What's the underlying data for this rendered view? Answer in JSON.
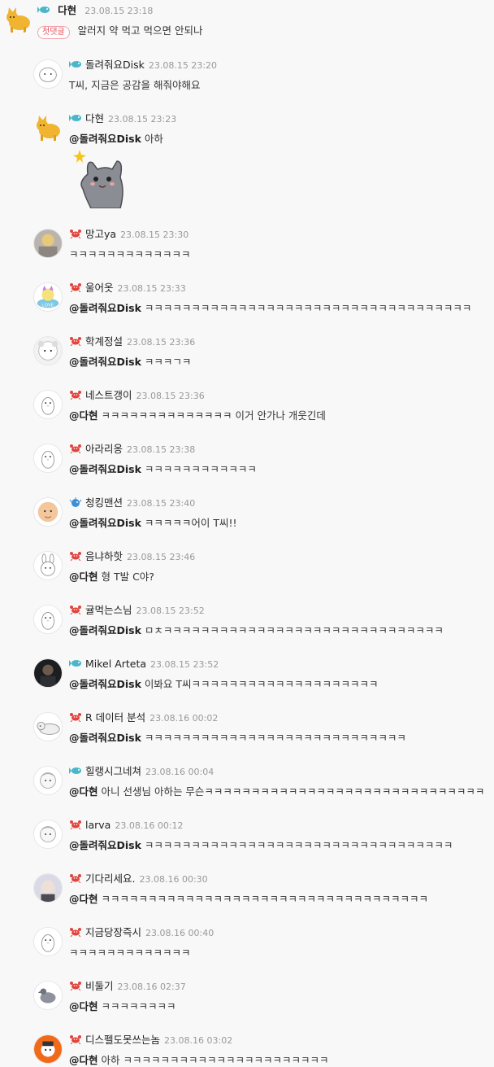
{
  "first_comment": {
    "nickname": "다현",
    "time": "23.08.15 23:18",
    "tag": "첫댓글",
    "text": "알러지 약 먹고 먹으면 안되나",
    "badge": "fish-badge",
    "avatar": "orange-cat"
  },
  "replies": [
    {
      "nickname": "돌려줘요Disk",
      "time": "23.08.15 23:20",
      "mention": "",
      "text": "T씨, 지금은 공감을 해줘야해요",
      "badge": "fish",
      "avatar": "white-blob"
    },
    {
      "nickname": "다현",
      "time": "23.08.15 23:23",
      "mention": "@돌려줘요Disk",
      "text": "아하",
      "badge": "fish",
      "avatar": "orange-cat",
      "sticker": "gray-cat-sticker"
    },
    {
      "nickname": "망고ya",
      "time": "23.08.15 23:30",
      "mention": "",
      "text": "ㅋㅋㅋㅋㅋㅋㅋㅋㅋㅋㅋㅋㅋ",
      "badge": "crab",
      "avatar": "photo-gray"
    },
    {
      "nickname": "울어옷",
      "time": "23.08.15 23:33",
      "mention": "@돌려줘요Disk",
      "text": "ㅋㅋㅋㅋㅋㅋㅋㅋㅋㅋㅋㅋㅋㅋㅋㅋㅋㅋㅋㅋㅋㅋㅋㅋㅋㅋㅋㅋㅋㅋㅋㅋㅋㅋㅋ",
      "badge": "crab",
      "avatar": "colorful-cat"
    },
    {
      "nickname": "학계정설",
      "time": "23.08.15 23:36",
      "mention": "@돌려줘요Disk",
      "text": "ㅋㅋㅋㄱㅋ",
      "badge": "crab",
      "avatar": "gray-bear"
    },
    {
      "nickname": "네스트갱이",
      "time": "23.08.15 23:36",
      "mention": "@다현",
      "text": "ㅋㅋㅋㅋㅋㅋㅋㅋㅋㅋㅋㅋㅋㅋ 이거 안가나 개웃긴데",
      "badge": "crab",
      "avatar": "penguin"
    },
    {
      "nickname": "아라리옹",
      "time": "23.08.15 23:38",
      "mention": "@돌려줘요Disk",
      "text": "ㅋㅋㅋㅋㅋㅋㅋㅋㅋㅋㅋㅋ",
      "badge": "crab",
      "avatar": "penguin"
    },
    {
      "nickname": "청킹맨션",
      "time": "23.08.15 23:40",
      "mention": "@돌려줘요Disk",
      "text": "ㅋㅋㅋㅋㅋ어이 T씨!!",
      "badge": "blowfish",
      "avatar": "bald-face"
    },
    {
      "nickname": "음냐하핫",
      "time": "23.08.15 23:46",
      "mention": "@다현",
      "text": "형 T발 C야?",
      "badge": "crab",
      "avatar": "bunny"
    },
    {
      "nickname": "귤먹는스님",
      "time": "23.08.15 23:52",
      "mention": "@돌려줘요Disk",
      "text": "ㅁㅊㅋㅋㅋㅋㅋㅋㅋㅋㅋㅋㅋㅋㅋㅋㅋㅋㅋㅋㅋㅋㅋㅋㅋㅋㅋㅋㅋㅋㅋㅋ",
      "badge": "crab",
      "avatar": "penguin"
    },
    {
      "nickname": "Mikel Arteta",
      "time": "23.08.15 23:52",
      "mention": "@돌려줘요Disk",
      "text": "이봐요 T씨ㅋㅋㅋㅋㅋㅋㅋㅋㅋㅋㅋㅋㅋㅋㅋㅋㅋㅋㅋㅋ",
      "badge": "fish",
      "avatar": "dark-photo"
    },
    {
      "nickname": "R 데이터 분석",
      "time": "23.08.16 00:02",
      "mention": "@돌려줘요Disk",
      "text": "ㅋㅋㅋㅋㅋㅋㅋㅋㅋㅋㅋㅋㅋㅋㅋㅋㅋㅋㅋㅋㅋㅋㅋㅋㅋㅋㅋㅋ",
      "badge": "crab",
      "avatar": "lying-cat"
    },
    {
      "nickname": "힐랭시그네쳐",
      "time": "23.08.16 00:04",
      "mention": "@다현",
      "text": "아니 선생님 아하는 무슨ㅋㅋㅋㅋㅋㅋㅋㅋㅋㅋㅋㅋㅋㅋㅋㅋㅋㅋㅋㅋㅋㅋㅋㅋㅋㅋㅋㅋㅋㅋ",
      "badge": "fish",
      "avatar": "sheep"
    },
    {
      "nickname": "larva",
      "time": "23.08.16 00:12",
      "mention": "@돌려줘요Disk",
      "text": "ㅋㅋㅋㅋㅋㅋㅋㅋㅋㅋㅋㅋㅋㅋㅋㅋㅋㅋㅋㅋㅋㅋㅋㅋㅋㅋㅋㅋㅋㅋㅋㅋㅋ",
      "badge": "crab",
      "avatar": "sheep"
    },
    {
      "nickname": "기다리세요.",
      "time": "23.08.16 00:30",
      "mention": "@다현",
      "text": "ㅋㅋㅋㅋㅋㅋㅋㅋㅋㅋㅋㅋㅋㅋㅋㅋㅋㅋㅋㅋㅋㅋㅋㅋㅋㅋㅋㅋㅋㅋㅋㅋㅋㅋㅋ",
      "badge": "crab",
      "avatar": "girl-photo"
    },
    {
      "nickname": "지금당장즉시",
      "time": "23.08.16 00:40",
      "mention": "",
      "text": "ㅋㅋㅋㅋㅋㅋㅋㅋㅋㅋㅋㅋㅋ",
      "badge": "crab",
      "avatar": "penguin"
    },
    {
      "nickname": "비둘기",
      "time": "23.08.16 02:37",
      "mention": "@다현",
      "text": "ㅋㅋㅋㅋㅋㅋㅋㅋ",
      "badge": "crab",
      "avatar": "pigeon"
    },
    {
      "nickname": "디스펠도못쓰는놈",
      "time": "23.08.16 03:02",
      "mention": "@다현",
      "text": "아하 ㅋㅋㅋㅋㅋㅋㅋㅋㅋㅋㅋㅋㅋㅋㅋㅋㅋㅋㅋㅋㅋㅋ",
      "badge": "crab",
      "avatar": "orange-char"
    }
  ]
}
